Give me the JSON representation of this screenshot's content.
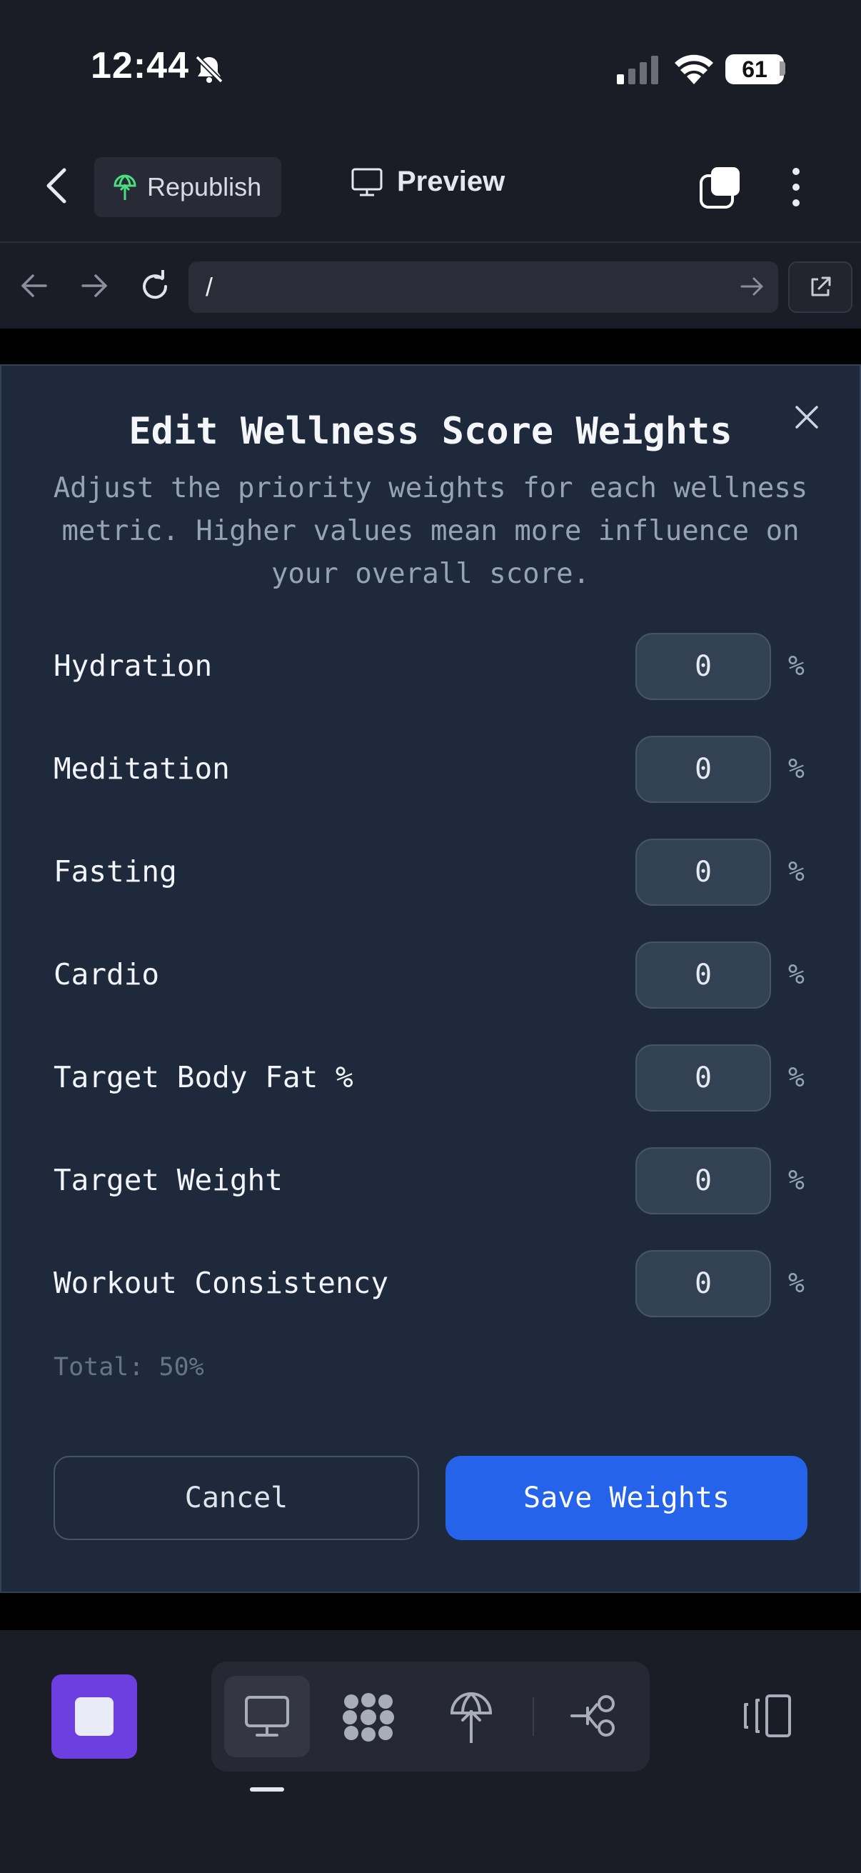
{
  "status_bar": {
    "time": "12:44",
    "battery": "61",
    "icons": [
      "bell-muted-icon",
      "cellular-signal-icon",
      "wifi-icon",
      "battery-icon"
    ]
  },
  "toolbar": {
    "republish_label": "Republish",
    "preview_label": "Preview",
    "icons": [
      "back-chevron-icon",
      "republish-icon",
      "monitor-icon",
      "stack-icon",
      "kebab-menu-icon"
    ]
  },
  "browser": {
    "url": "/",
    "icons": [
      "arrow-left-icon",
      "arrow-right-icon",
      "reload-icon",
      "go-arrow-icon",
      "open-external-icon"
    ]
  },
  "modal": {
    "title": "Edit Wellness Score Weights",
    "description": "Adjust the priority weights for each wellness metric. Higher values mean more influence on your overall score.",
    "rows": [
      {
        "label": "Hydration",
        "value": "0",
        "unit": "%"
      },
      {
        "label": "Meditation",
        "value": "0",
        "unit": "%"
      },
      {
        "label": "Fasting",
        "value": "0",
        "unit": "%"
      },
      {
        "label": "Cardio",
        "value": "0",
        "unit": "%"
      },
      {
        "label": "Target Body Fat %",
        "value": "0",
        "unit": "%"
      },
      {
        "label": "Target Weight",
        "value": "0",
        "unit": "%"
      },
      {
        "label": "Workout Consistency",
        "value": "0",
        "unit": "%"
      }
    ],
    "total": "Total: 50%",
    "cancel_label": "Cancel",
    "save_label": "Save Weights"
  },
  "bottom_bar": {
    "icons": [
      "stop-icon",
      "desktop-icon",
      "apps-grid-icon",
      "deploy-icon",
      "connector-icon",
      "panel-toggle-icon"
    ]
  },
  "colors": {
    "modal_bg": "#1e293b",
    "input_bg": "#334155",
    "primary": "#2563eb",
    "accent_purple": "#6d3fe0",
    "republish_green": "#4ade80"
  }
}
